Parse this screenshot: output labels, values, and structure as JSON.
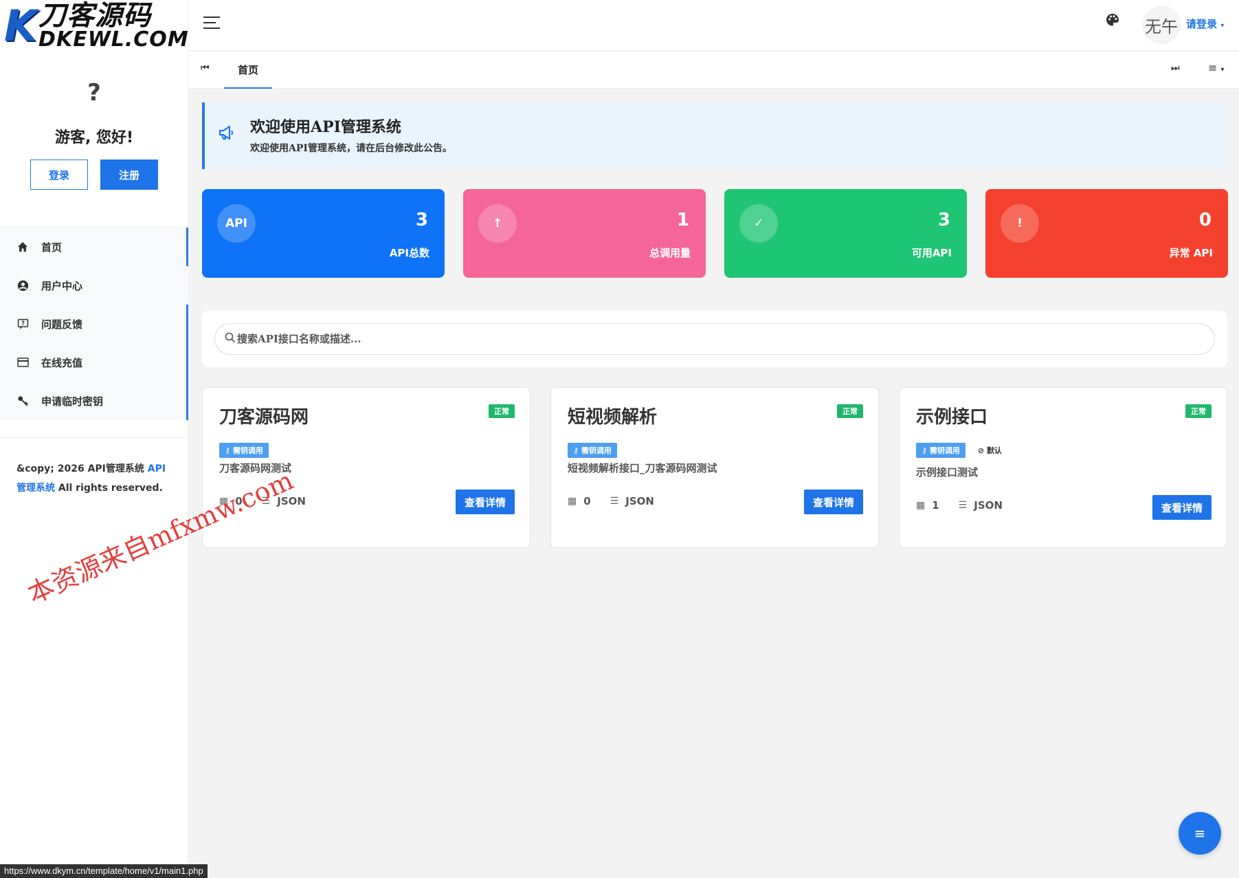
{
  "brand": {
    "logo_mark": "K",
    "logo_cn": "刀客源码",
    "logo_en": "DKEWL.COM"
  },
  "colors": {
    "primary": "#1e74e8",
    "stat_api": "#0e73f6",
    "stat_calls": "#f56598",
    "stat_ok": "#1ec573",
    "stat_err": "#f4412e",
    "badge_ok": "#1fb86a"
  },
  "sidebar": {
    "avatar": "?",
    "greeting": "游客, 您好!",
    "login_label": "登录",
    "register_label": "注册",
    "items": [
      {
        "label": "首页",
        "icon": "home-icon"
      },
      {
        "label": "用户中心",
        "icon": "user-circle-icon"
      },
      {
        "label": "问题反馈",
        "icon": "feedback-icon"
      },
      {
        "label": "在线充值",
        "icon": "credit-card-icon"
      },
      {
        "label": "申请临时密钥",
        "icon": "key-icon"
      }
    ],
    "copyright_prefix": "&copy; 2026 API管理系统 ",
    "copyright_link": "API管理系统",
    "copyright_suffix": " All rights reserved."
  },
  "header": {
    "user_avatar_text": "无午",
    "login_link": "请登录"
  },
  "tabs": {
    "home": "首页"
  },
  "notice": {
    "title": "欢迎使用API管理系统",
    "text": "欢迎使用API管理系统，请在后台修改此公告。"
  },
  "stats": [
    {
      "icon_text": "API",
      "value": "3",
      "label": "API总数"
    },
    {
      "icon_text": "↑",
      "value": "1",
      "label": "总调用量"
    },
    {
      "icon_text": "✓",
      "value": "3",
      "label": "可用API"
    },
    {
      "icon_text": "!",
      "value": "0",
      "label": "异常 API"
    }
  ],
  "search": {
    "placeholder": "搜索API接口名称或描述..."
  },
  "apis": [
    {
      "title": "刀客源码网",
      "status": "正常",
      "key_tag": "需钥调用",
      "extra_tag": "",
      "desc": "刀客源码网测试",
      "count": "0",
      "format": "JSON",
      "button": "查看详情"
    },
    {
      "title": "短视频解析",
      "status": "正常",
      "key_tag": "需钥调用",
      "extra_tag": "",
      "desc": "短视频解析接口_刀客源码网测试",
      "count": "0",
      "format": "JSON",
      "button": "查看详情"
    },
    {
      "title": "示例接口",
      "status": "正常",
      "key_tag": "需钥调用",
      "extra_tag": "默认",
      "desc": "示例接口测试",
      "count": "1",
      "format": "JSON",
      "button": "查看详情"
    }
  ],
  "watermark": "本资源来自mfxmw.com",
  "status_url": "https://www.dkym.cn/template/home/v1/main1.php"
}
